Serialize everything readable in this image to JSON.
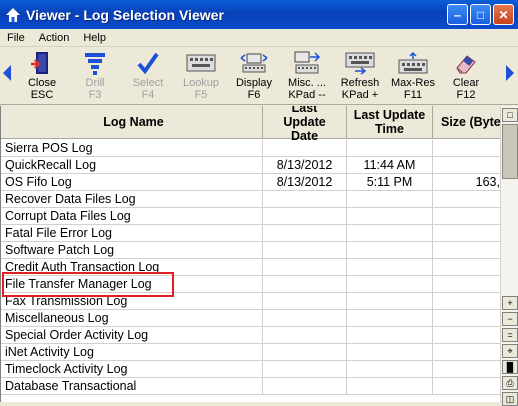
{
  "window": {
    "title": "Viewer - Log Selection Viewer"
  },
  "menu": [
    "File",
    "Action",
    "Help"
  ],
  "toolbar": [
    {
      "line1": "Close",
      "line2": "ESC",
      "icon": "close-door-icon",
      "enabled": true
    },
    {
      "line1": "Drill",
      "line2": "F3",
      "icon": "drill-funnel-icon",
      "enabled": false
    },
    {
      "line1": "Select",
      "line2": "F4",
      "icon": "select-check-icon",
      "enabled": false
    },
    {
      "line1": "Lookup",
      "line2": "F5",
      "icon": "lookup-keyboard-icon",
      "enabled": false
    },
    {
      "line1": "Display",
      "line2": "F6",
      "icon": "display-icon",
      "enabled": true
    },
    {
      "line1": "Misc. ...",
      "line2": "KPad --",
      "icon": "misc-folder-icon",
      "enabled": true
    },
    {
      "line1": "Refresh",
      "line2": "KPad +",
      "icon": "refresh-icon",
      "enabled": true
    },
    {
      "line1": "Max-Res",
      "line2": "F11",
      "icon": "max-res-icon",
      "enabled": true
    },
    {
      "line1": "Clear",
      "line2": "F12",
      "icon": "clear-eraser-icon",
      "enabled": true
    }
  ],
  "grid": {
    "headers": [
      "Log Name",
      "Last Update Date",
      "Last Update Time",
      "Size (Byte"
    ],
    "rows": [
      {
        "name": "Sierra POS Log",
        "date": "",
        "time": "",
        "size": ""
      },
      {
        "name": "QuickRecall Log",
        "date": "8/13/2012",
        "time": "11:44 AM",
        "size": ""
      },
      {
        "name": "OS Fifo Log",
        "date": "8/13/2012",
        "time": "5:11 PM",
        "size": "163,"
      },
      {
        "name": "Recover Data Files Log",
        "date": "",
        "time": "",
        "size": ""
      },
      {
        "name": "Corrupt Data Files Log",
        "date": "",
        "time": "",
        "size": ""
      },
      {
        "name": "Fatal File Error Log",
        "date": "",
        "time": "",
        "size": ""
      },
      {
        "name": "Software Patch Log",
        "date": "",
        "time": "",
        "size": ""
      },
      {
        "name": "Credit Auth Transaction Log",
        "date": "",
        "time": "",
        "size": ""
      },
      {
        "name": "File Transfer Manager Log",
        "date": "",
        "time": "",
        "size": ""
      },
      {
        "name": "Fax Transmission Log",
        "date": "",
        "time": "",
        "size": ""
      },
      {
        "name": "Miscellaneous Log",
        "date": "",
        "time": "",
        "size": ""
      },
      {
        "name": "Special Order Activity Log",
        "date": "",
        "time": "",
        "size": ""
      },
      {
        "name": "iNet Activity Log",
        "date": "",
        "time": "",
        "size": ""
      },
      {
        "name": "Timeclock Activity Log",
        "date": "",
        "time": "",
        "size": ""
      },
      {
        "name": "Database Transactional",
        "date": "",
        "time": "",
        "size": ""
      }
    ]
  },
  "highlighted_row": "File Transfer Manager Log"
}
